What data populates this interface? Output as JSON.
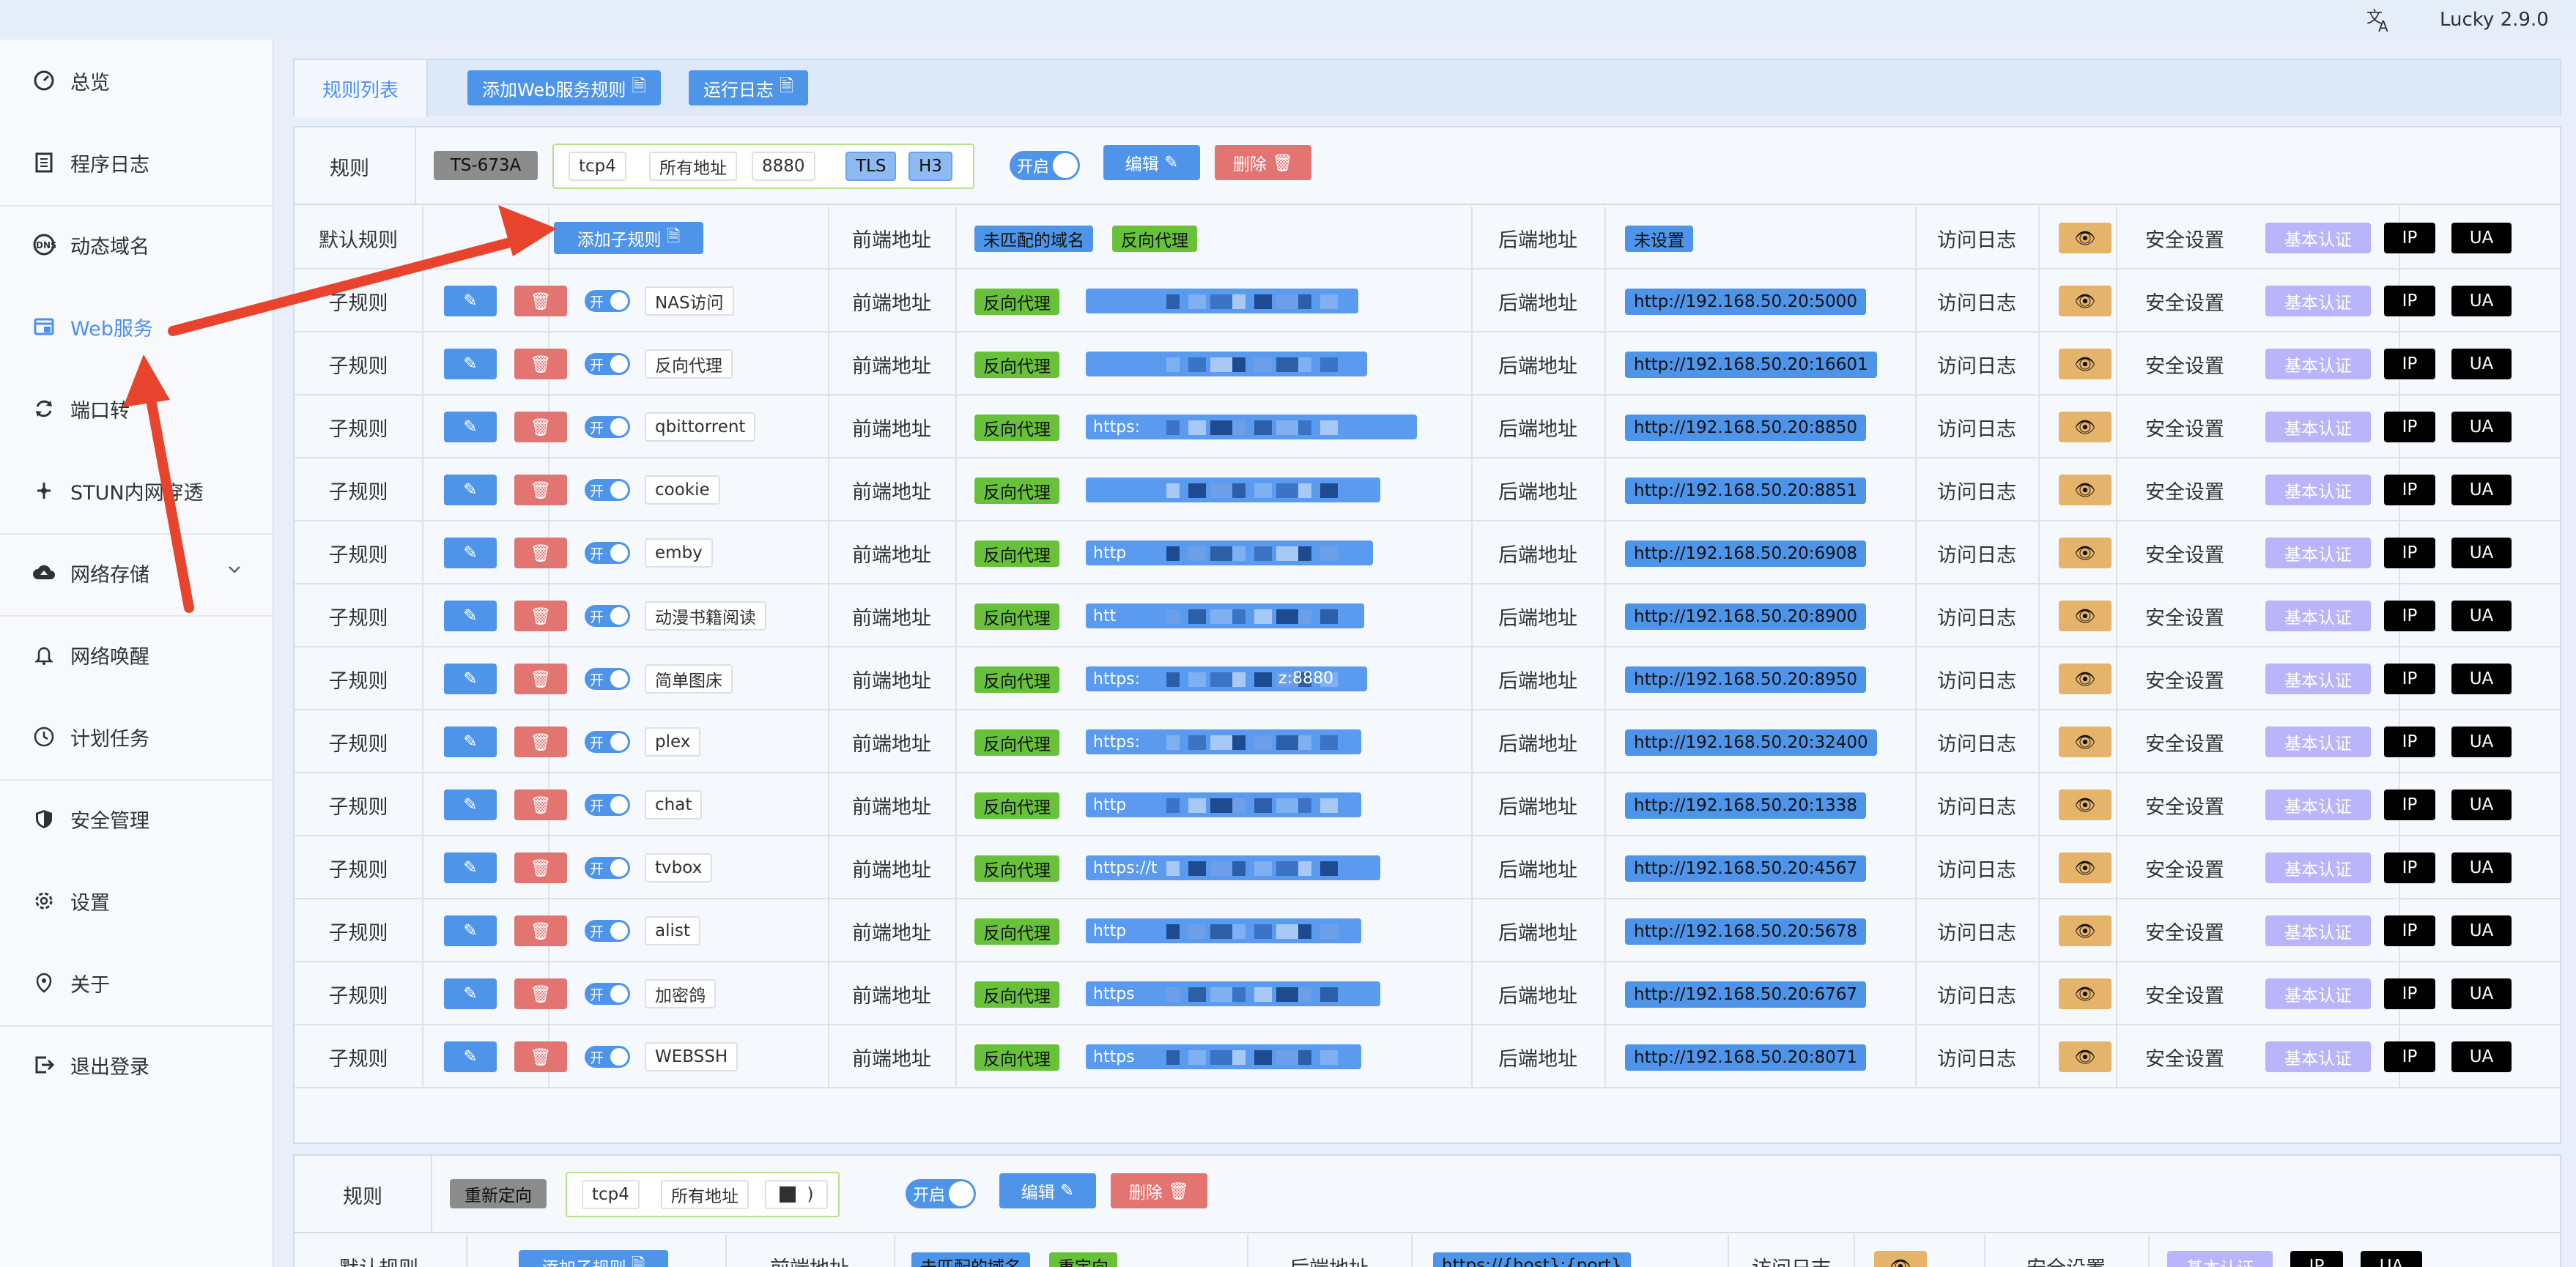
{
  "app": {
    "version": "Lucky 2.9.0",
    "lang_icon": "translate-icon"
  },
  "sidebar": {
    "items": [
      {
        "label": "总览",
        "icon": "dashboard-icon"
      },
      {
        "label": "程序日志",
        "icon": "log-icon"
      },
      {
        "label": "动态域名",
        "icon": "dns-icon"
      },
      {
        "label": "Web服务",
        "icon": "web-service-icon",
        "active": true
      },
      {
        "label": "端口转",
        "icon": "port-forward-icon"
      },
      {
        "label": "STUN内网穿透",
        "icon": "stun-icon"
      },
      {
        "label": "网络存储",
        "icon": "cloud-upload-icon"
      },
      {
        "label": "网络唤醒",
        "icon": "bell-icon"
      },
      {
        "label": "计划任务",
        "icon": "clock-icon"
      },
      {
        "label": "安全管理",
        "icon": "shield-icon"
      },
      {
        "label": "设置",
        "icon": "gear-icon"
      },
      {
        "label": "关于",
        "icon": "about-icon"
      },
      {
        "label": "退出登录",
        "icon": "logout-icon"
      }
    ]
  },
  "tabs": {
    "active": "规则列表",
    "add_rule": "添加Web服务规则",
    "run_log": "运行日志"
  },
  "labels": {
    "rule": "规则",
    "default_rule": "默认规则",
    "sub_rule": "子规则",
    "add_sub_rule": "添加子规则",
    "frontend": "前端地址",
    "backend": "后端地址",
    "access_log": "访问日志",
    "security": "安全设置",
    "basic_auth": "基本认证",
    "ip": "IP",
    "ua": "UA",
    "on": "开启",
    "on_short": "开",
    "edit": "编辑",
    "delete": "删除",
    "unmatched_domain": "未匹配的域名",
    "reverse_proxy": "反向代理",
    "redirect": "重定向",
    "not_set": "未设置"
  },
  "rule1": {
    "name": "TS-673A",
    "protocol": "tcp4",
    "address": "所有地址",
    "port": "8880",
    "tls": "TLS",
    "h3": "H3",
    "subrules": [
      {
        "name": "NAS访问",
        "frontend": "",
        "backend": "http://192.168.50.20:5000"
      },
      {
        "name": "反向代理",
        "frontend": "",
        "backend": "http://192.168.50.20:16601"
      },
      {
        "name": "qbittorrent",
        "frontend": "https:",
        "backend": "http://192.168.50.20:8850"
      },
      {
        "name": "cookie",
        "frontend": "",
        "backend": "http://192.168.50.20:8851"
      },
      {
        "name": "emby",
        "frontend": "http",
        "backend": "http://192.168.50.20:6908"
      },
      {
        "name": "动漫书籍阅读",
        "frontend": "htt",
        "backend": "http://192.168.50.20:8900"
      },
      {
        "name": "简单图床",
        "frontend": "https:",
        "frontend_tail": "z:8880",
        "backend": "http://192.168.50.20:8950"
      },
      {
        "name": "plex",
        "frontend": "https:",
        "backend": "http://192.168.50.20:32400"
      },
      {
        "name": "chat",
        "frontend": "http",
        "backend": "http://192.168.50.20:1338"
      },
      {
        "name": "tvbox",
        "frontend": "https://t",
        "backend": "http://192.168.50.20:4567"
      },
      {
        "name": "alist",
        "frontend": "http",
        "backend": "http://192.168.50.20:5678"
      },
      {
        "name": "加密鸽",
        "frontend": "https",
        "backend": "http://192.168.50.20:6767"
      },
      {
        "name": "WEBSSH",
        "frontend": "https",
        "backend": "http://192.168.50.20:8071"
      }
    ]
  },
  "rule2": {
    "name": "重新定向",
    "protocol": "tcp4",
    "address": "所有地址",
    "port": ")",
    "backend": "https://{host}:{port}"
  }
}
